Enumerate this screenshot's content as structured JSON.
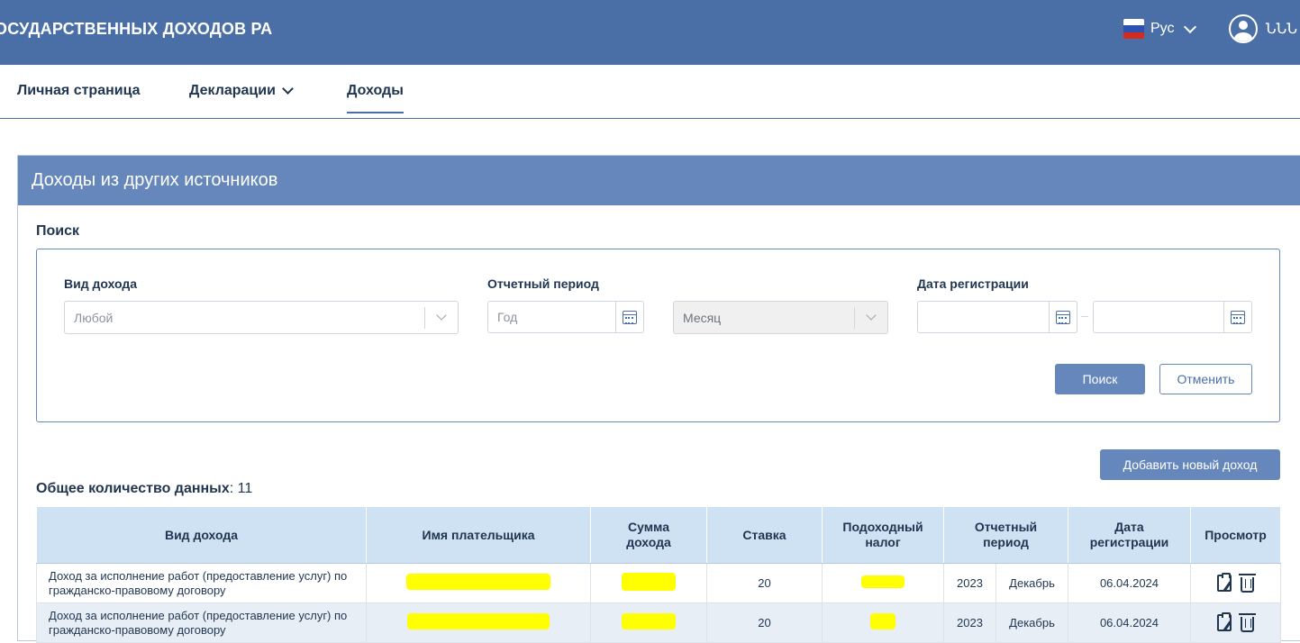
{
  "header": {
    "title": "ОСУДАРСТВЕННЫХ ДОХОДОВ РА",
    "language": "Рус",
    "user_label": "ՆՆՆ",
    "flag_colors": [
      "#ffffff",
      "#2c51b0",
      "#d52b1e"
    ]
  },
  "nav": {
    "items": [
      {
        "label": "Личная страница"
      },
      {
        "label": "Декларации"
      },
      {
        "label": "Доходы"
      }
    ],
    "active": "Доходы"
  },
  "card": {
    "title": "Доходы из других источников"
  },
  "search": {
    "heading": "Поиск",
    "income_type_label": "Вид дохода",
    "income_type_value": "Любой",
    "period_label": "Отчетный период",
    "year_placeholder": "Год",
    "month_value": "Месяц",
    "registration_label": "Дата регистрации",
    "search_button": "Поиск",
    "cancel_button": "Отменить"
  },
  "add_button": "Добавить новый доход",
  "total": {
    "label": "Общее количество данных",
    "value": ": 11"
  },
  "table": {
    "headers": [
      "Вид дохода",
      "Имя плательщика",
      "Сумма дохода",
      "Ставка",
      "Подоходный налог",
      "Отчетный период",
      "Дата регистрации",
      "Просмотр"
    ],
    "rows": [
      {
        "income_type": "Доход за исполнение работ (предоставление услуг) по гражданско-правовому договору",
        "rate": "20",
        "year": "2023",
        "month": "Декабрь",
        "date": "06.04.2024"
      },
      {
        "income_type": "Доход за исполнение работ (предоставление услуг) по гражданско-правовому договору",
        "rate": "20",
        "year": "2023",
        "month": "Декабрь",
        "date": "06.04.2024"
      }
    ]
  },
  "colors": {
    "header_bg": "#4a6fa6",
    "card_header_bg": "#6587bc",
    "table_header_bg": "#cfe2f3",
    "redaction": "#ffff00"
  }
}
